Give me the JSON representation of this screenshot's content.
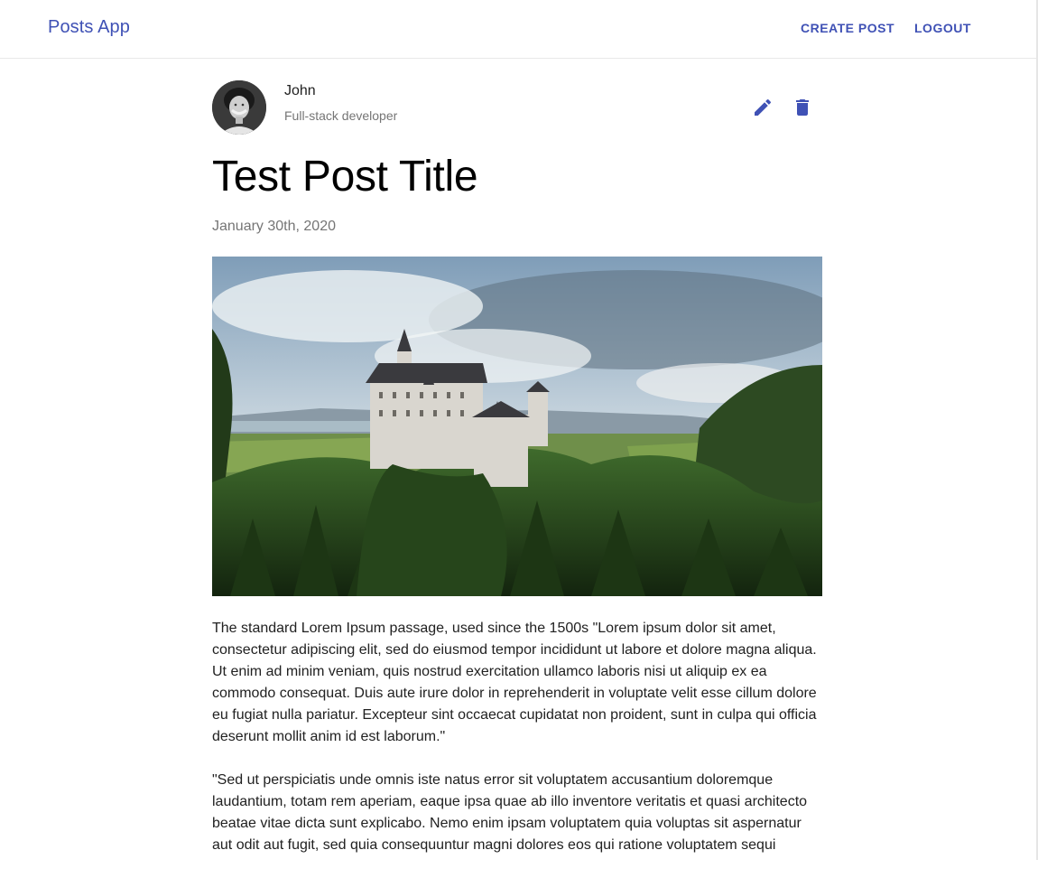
{
  "header": {
    "brand": "Posts App",
    "create_label": "CREATE POST",
    "logout_label": "LOGOUT"
  },
  "author": {
    "name": "John",
    "role": "Full-stack developer"
  },
  "actions": {
    "edit_icon": "pencil-icon",
    "delete_icon": "trash-icon"
  },
  "post": {
    "title": "Test Post Title",
    "date": "January 30th, 2020",
    "image": "castle-landscape",
    "paragraphs": [
      "The standard Lorem Ipsum passage, used since the 1500s \"Lorem ipsum dolor sit amet, consectetur adipiscing elit, sed do eiusmod tempor incididunt ut labore et dolore magna aliqua. Ut enim ad minim veniam, quis nostrud exercitation ullamco laboris nisi ut aliquip ex ea commodo consequat. Duis aute irure dolor in reprehenderit in voluptate velit esse cillum dolore eu fugiat nulla pariatur. Excepteur sint occaecat cupidatat non proident, sunt in culpa qui officia deserunt mollit anim id est laborum.\"",
      "\"Sed ut perspiciatis unde omnis iste natus error sit voluptatem accusantium doloremque laudantium, totam rem aperiam, eaque ipsa quae ab illo inventore veritatis et quasi architecto beatae vitae dicta sunt explicabo. Nemo enim ipsam voluptatem quia voluptas sit aspernatur aut odit aut fugit, sed quia consequuntur magni dolores eos qui ratione voluptatem sequi"
    ]
  },
  "colors": {
    "primary": "#3f51b5",
    "secondary_text": "#757575"
  }
}
